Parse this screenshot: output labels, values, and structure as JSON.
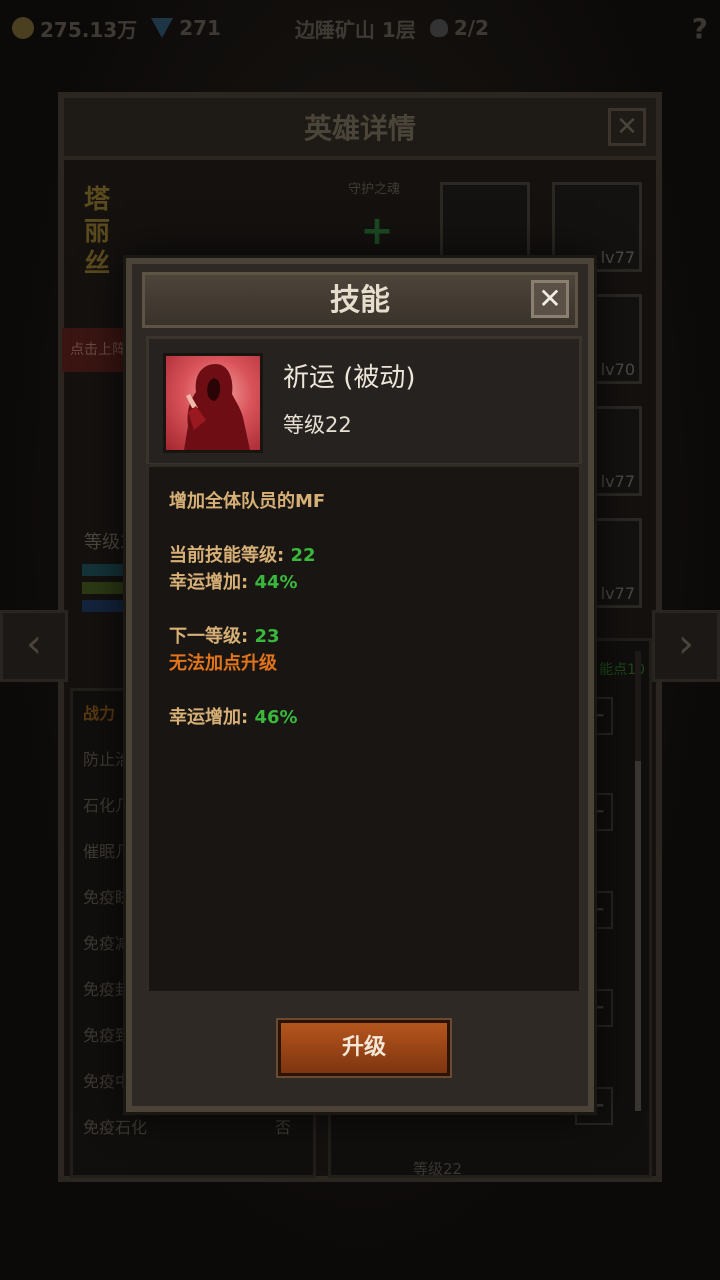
{
  "topbar": {
    "gold": "275.13万",
    "gems": "271",
    "location": "边陲矿山 1层",
    "skull_count": "2/2",
    "help": "?"
  },
  "hero_panel": {
    "title": "英雄详情",
    "close": "✕",
    "hero_name": "塔丽丝",
    "guard_label": "守护之魂",
    "guard_plus": "+",
    "deploy_button": "点击上阵",
    "level_label": "等级3",
    "stats": [
      {
        "label": "战力",
        "value": ""
      },
      {
        "label": "防止治",
        "value": ""
      },
      {
        "label": "石化几",
        "value": ""
      },
      {
        "label": "催眠几",
        "value": ""
      },
      {
        "label": "免疫眩",
        "value": ""
      },
      {
        "label": "免疫减",
        "value": ""
      },
      {
        "label": "免疫封",
        "value": ""
      },
      {
        "label": "免疫致",
        "value": ""
      },
      {
        "label": "免疫中",
        "value": ""
      },
      {
        "label": "免疫石化",
        "value": "否"
      }
    ],
    "equip_levels": [
      "lv77",
      "lv70",
      "lv77",
      "lv77"
    ],
    "skill_points": "能点10",
    "bottom_skill_level": "等级22",
    "prev": "‹",
    "next": "›"
  },
  "dialog": {
    "title": "技能",
    "close": "✕",
    "skill_name": "祈运 (被动)",
    "skill_level": "等级22",
    "description": "增加全体队员的MF",
    "current_level_label": "当前技能等级:",
    "current_level_value": "22",
    "luck_label": "幸运增加:",
    "luck_current": "44%",
    "next_level_label": "下一等级:",
    "next_level_value": "23",
    "cannot_upgrade": "无法加点升级",
    "luck_next_label": "幸运增加:",
    "luck_next": "46%",
    "upgrade_button": "升级"
  },
  "colors": {
    "accent_gold": "#d7b076",
    "value_green": "#39b83b",
    "warning_orange": "#e2741b",
    "button_orange": "#b5551d"
  }
}
